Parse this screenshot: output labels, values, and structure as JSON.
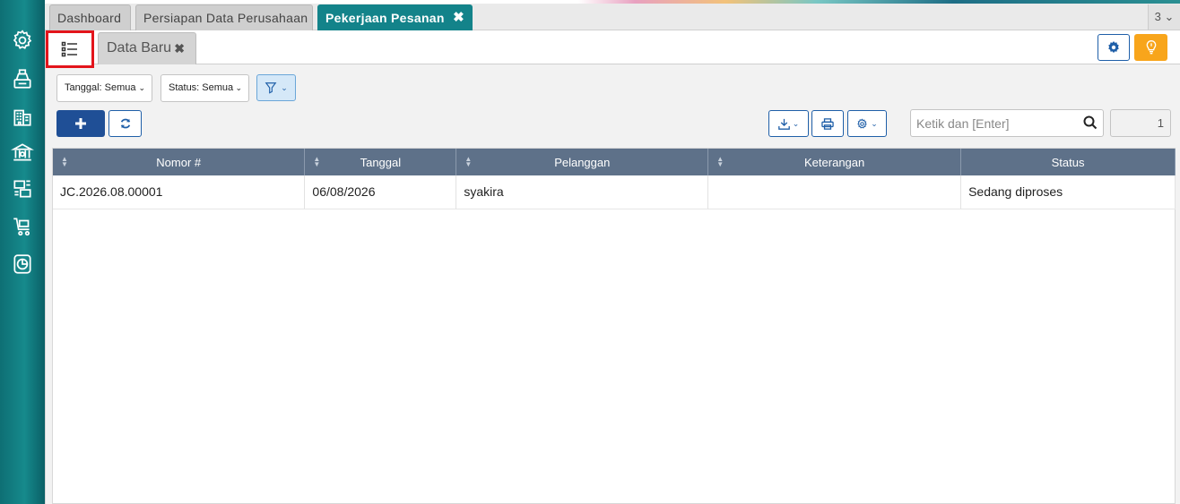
{
  "tabs": [
    {
      "label": "Dashboard"
    },
    {
      "label": "Persiapan Data Perusahaan"
    },
    {
      "label": "Pekerjaan Pesanan",
      "active": true
    }
  ],
  "tab_close_glyph": "✖",
  "tab_count": "3 ⌄",
  "sidebar": {
    "icons": [
      "gear-icon",
      "cash-register-icon",
      "building-icon",
      "bank-icon",
      "production-icon",
      "cart-icon",
      "report-icon"
    ]
  },
  "subtab": {
    "label": "Data Baru",
    "close_glyph": "✖"
  },
  "filters": {
    "tanggal": "Tanggal: Semua",
    "status": "Status: Semua",
    "chevron": "⌄"
  },
  "search": {
    "placeholder": "Ketik dan [Enter]"
  },
  "page_number": "1",
  "table": {
    "columns": [
      "Nomor #",
      "Tanggal",
      "Pelanggan",
      "Keterangan",
      "Status"
    ],
    "rows": [
      {
        "nomor": "JC.2026.08.00001",
        "tanggal": "06/08/2026",
        "pelanggan": "syakira",
        "keterangan": "",
        "status": "Sedang diproses"
      }
    ]
  },
  "colors": {
    "sidebar": "#13838a",
    "active_tab": "#13838a",
    "header": "#5e7189",
    "primary": "#1f4f96",
    "warning": "#f8a51b",
    "highlight_box": "#e3141b"
  }
}
